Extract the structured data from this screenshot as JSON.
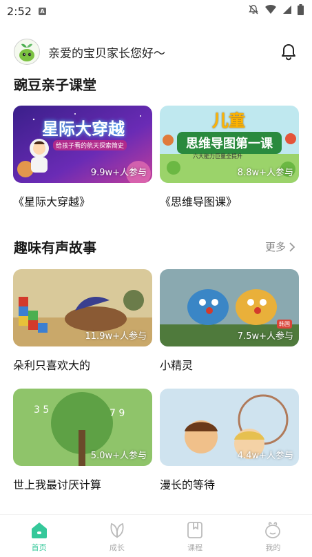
{
  "status_bar": {
    "time": "2:52",
    "app_indicator": "A"
  },
  "header": {
    "greeting": "亲爱的宝贝家长您好〜"
  },
  "section1": {
    "title": "豌豆亲子课堂",
    "cards": [
      {
        "title": "《星际大穿越》",
        "participants": "9.9w+人参与",
        "art_title": "星际大穿越",
        "art_subtitle": "给孩子看的航天探索简史"
      },
      {
        "title": "《思维导图课》",
        "participants": "8.8w+人参与",
        "art_top": "儿童",
        "art_title": "思维导图第一课",
        "art_subtitle": "六大能力巨量全提升"
      }
    ]
  },
  "section2": {
    "title": "趣味有声故事",
    "more": "更多",
    "cards": [
      {
        "title": "朵利只喜欢大的",
        "participants": "11.9w+人参与"
      },
      {
        "title": "小精灵",
        "participants": "7.5w+人参与",
        "tag": "韩国"
      },
      {
        "title": "世上我最讨厌计算",
        "participants": "5.0w+人参与"
      },
      {
        "title": "漫长的等待",
        "participants": "4.4w+人参与"
      }
    ]
  },
  "tabs": [
    {
      "label": "首页",
      "icon": "home-icon",
      "active": true
    },
    {
      "label": "成长",
      "icon": "leaf-icon",
      "active": false
    },
    {
      "label": "课程",
      "icon": "bookmark-icon",
      "active": false
    },
    {
      "label": "我的",
      "icon": "profile-icon",
      "active": false
    }
  ],
  "colors": {
    "accent": "#35c89a",
    "text": "#1a1a1a",
    "muted": "#888888"
  }
}
